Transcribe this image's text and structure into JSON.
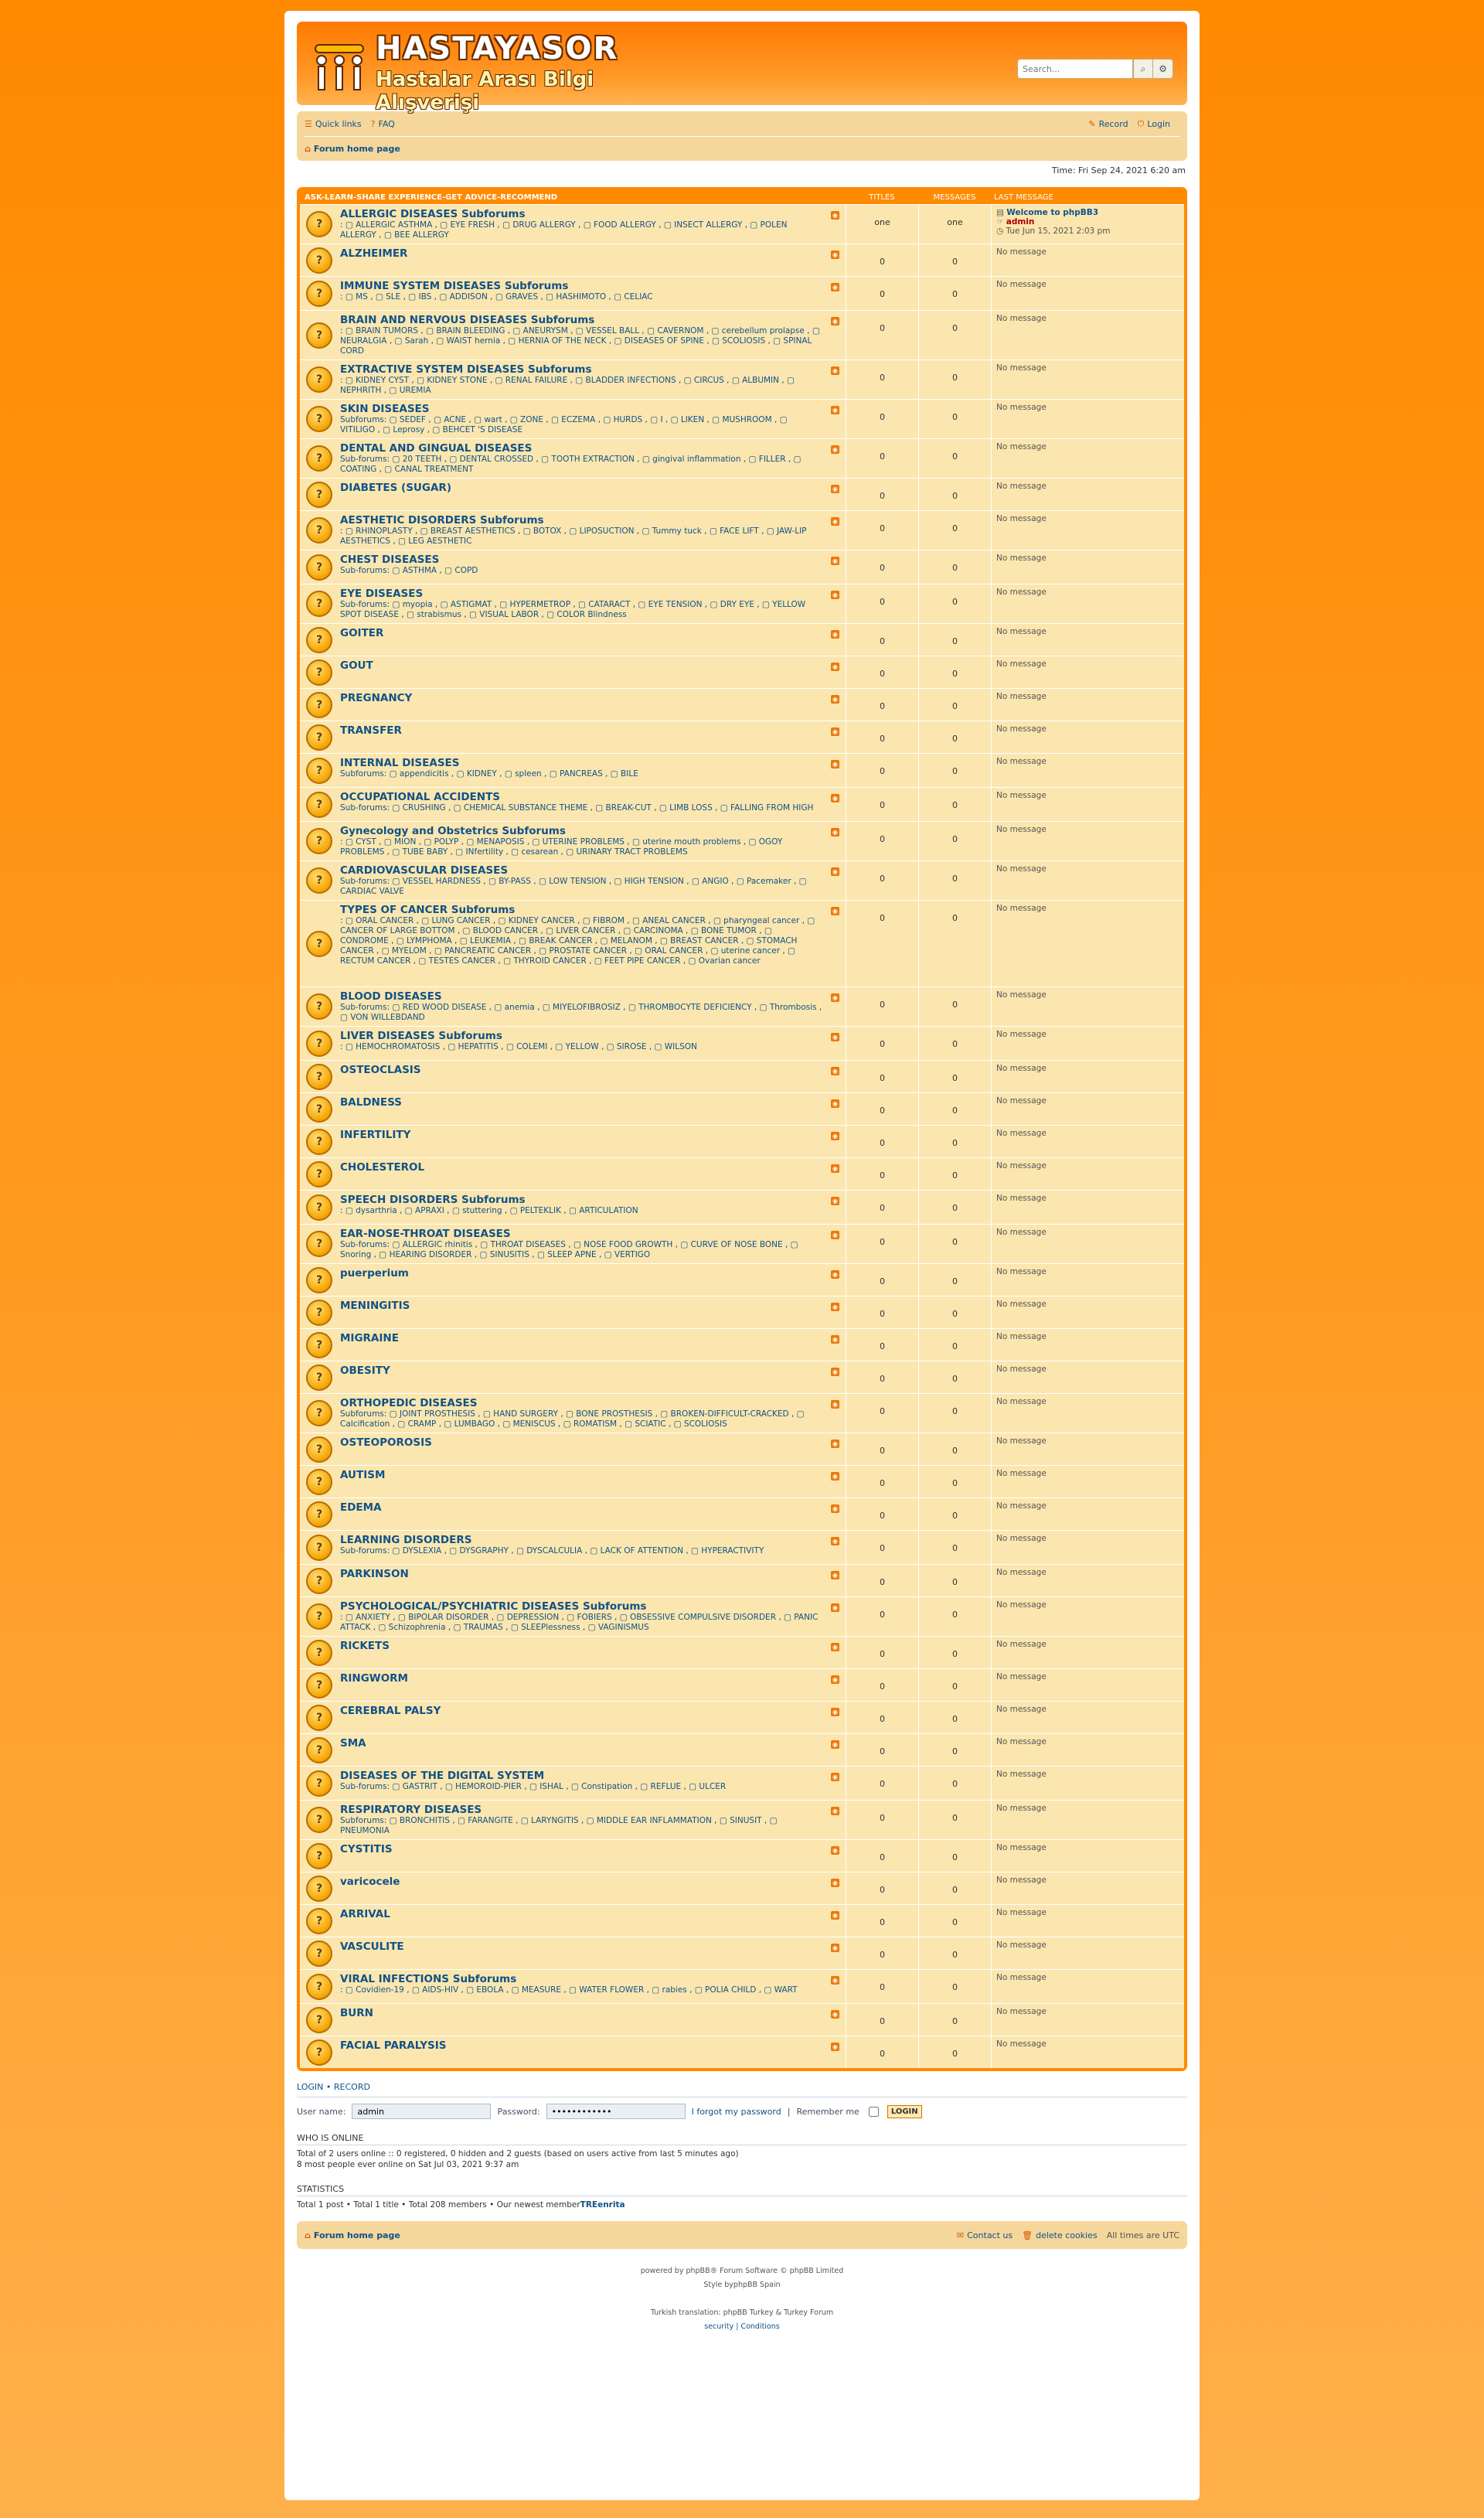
{
  "header": {
    "logo_title": "HASTAYASOR",
    "logo_subtitle": "Hastalar Arası Bilgi Alışverişi",
    "search_placeholder": "Search..."
  },
  "nav": {
    "quick_links": "Quick links",
    "faq": "FAQ",
    "register": "Record",
    "login": "Login",
    "breadcrumb": "Forum home page"
  },
  "time": "Time: Fri Sep 24, 2021 6:20 am",
  "category": {
    "title": "ASK-LEARN-SHARE EXPERIENCE-GET ADVICE-RECOMMEND",
    "col_titles": "TITLES",
    "col_messages": "MESSAGES",
    "col_last": "LAST MESSAGE"
  },
  "forums": [
    {
      "name": "ALLERGIC DISEASES Subforums",
      "subs": ": ▢ ALLERGIC ASTHMA , ▢ EYE FRESH , ▢ DRUG ALLERGY , ▢ FOOD ALLERGY , ▢ INSECT ALLERGY , ▢ POLEN ALLERGY , ▢ BEE ALLERGY",
      "titles": "one",
      "messages": "one",
      "last_title": "Welcome to phpBB3",
      "last_user": "admin",
      "last_date": "Tue Jun 15, 2021 2:03 pm"
    },
    {
      "name": "ALZHEIMER",
      "subs": "",
      "titles": "0",
      "messages": "0",
      "last": "No message"
    },
    {
      "name": "IMMUNE SYSTEM DISEASES Subforums",
      "subs": ": ▢ MS , ▢ SLE , ▢ IBS , ▢ ADDISON , ▢ GRAVES , ▢ HASHIMOTO , ▢ CELIAC",
      "titles": "0",
      "messages": "0",
      "last": "No message"
    },
    {
      "name": "BRAIN AND NERVOUS DISEASES Subforums",
      "subs": ": ▢ BRAIN TUMORS , ▢ BRAIN BLEEDING , ▢ ANEURYSM , ▢ VESSEL BALL , ▢ CAVERNOM , ▢ cerebellum prolapse , ▢ NEURALGIA , ▢ Sarah , ▢ WAIST hernia , ▢ HERNIA OF THE NECK , ▢ DISEASES OF SPINE , ▢ SCOLIOSIS , ▢ SPINAL CORD",
      "titles": "0",
      "messages": "0",
      "last": "No message"
    },
    {
      "name": "EXTRACTIVE SYSTEM DISEASES Subforums",
      "subs": ": ▢ KIDNEY CYST , ▢ KIDNEY STONE , ▢ RENAL FAILURE , ▢ BLADDER INFECTIONS , ▢ CIRCUS , ▢ ALBUMIN , ▢ NEPHRITH , ▢ UREMIA",
      "titles": "0",
      "messages": "0",
      "last": "No message"
    },
    {
      "name": "SKIN DISEASES",
      "subs": "Subforums: ▢ SEDEF , ▢ ACNE , ▢ wart , ▢ ZONE , ▢ ECZEMA , ▢ HURDS , ▢ I , ▢ LIKEN , ▢ MUSHROOM , ▢ VITILIGO , ▢ Leprosy , ▢ BEHCET 'S DISEASE",
      "titles": "0",
      "messages": "0",
      "last": "No message"
    },
    {
      "name": "DENTAL AND GINGUAL DISEASES",
      "subs": "Sub-forums: ▢ 20 TEETH , ▢ DENTAL CROSSED , ▢ TOOTH EXTRACTION , ▢ gingival inflammation , ▢ FILLER , ▢ COATING , ▢ CANAL TREATMENT",
      "titles": "0",
      "messages": "0",
      "last": "No message"
    },
    {
      "name": "DIABETES (SUGAR)",
      "subs": "",
      "titles": "0",
      "messages": "0",
      "last": "No message"
    },
    {
      "name": "AESTHETIC DISORDERS Subforums",
      "subs": ": ▢ RHINOPLASTY , ▢ BREAST AESTHETICS , ▢ BOTOX , ▢ LIPOSUCTION , ▢ Tummy tuck , ▢ FACE LIFT , ▢ JAW-LIP AESTHETICS , ▢ LEG AESTHETIC",
      "titles": "0",
      "messages": "0",
      "last": "No message"
    },
    {
      "name": "CHEST DISEASES",
      "subs": "Sub-forums: ▢ ASTHMA , ▢ COPD",
      "titles": "0",
      "messages": "0",
      "last": "No message"
    },
    {
      "name": "EYE DISEASES",
      "subs": "Sub-forums: ▢ myopia , ▢ ASTIGMAT , ▢ HYPERMETROP , ▢ CATARACT , ▢ EYE TENSION , ▢ DRY EYE , ▢ YELLOW SPOT DISEASE , ▢ strabismus , ▢ VISUAL LABOR , ▢ COLOR Blindness",
      "titles": "0",
      "messages": "0",
      "last": "No message"
    },
    {
      "name": "GOITER",
      "subs": "",
      "titles": "0",
      "messages": "0",
      "last": "No message"
    },
    {
      "name": "GOUT",
      "subs": "",
      "titles": "0",
      "messages": "0",
      "last": "No message"
    },
    {
      "name": "PREGNANCY",
      "subs": "",
      "titles": "0",
      "messages": "0",
      "last": "No message"
    },
    {
      "name": "TRANSFER",
      "subs": "",
      "titles": "0",
      "messages": "0",
      "last": "No message"
    },
    {
      "name": "INTERNAL DISEASES",
      "subs": "Subforums: ▢ appendicitis , ▢ KIDNEY , ▢ spleen , ▢ PANCREAS , ▢ BILE",
      "titles": "0",
      "messages": "0",
      "last": "No message"
    },
    {
      "name": "OCCUPATIONAL ACCIDENTS",
      "subs": "Sub-forums: ▢ CRUSHING , ▢ CHEMICAL SUBSTANCE THEME , ▢ BREAK-CUT , ▢ LIMB LOSS , ▢ FALLING FROM HIGH",
      "titles": "0",
      "messages": "0",
      "last": "No message"
    },
    {
      "name": "Gynecology and Obstetrics Subforums",
      "subs": ": ▢ CYST , ▢ MION , ▢ POLYP , ▢ MENAPOSIS , ▢ UTERINE PROBLEMS , ▢ uterine mouth problems , ▢ OGOY PROBLEMS , ▢ TUBE BABY , ▢ INfertility , ▢ cesarean , ▢ URINARY TRACT PROBLEMS",
      "titles": "0",
      "messages": "0",
      "last": "No message"
    },
    {
      "name": "CARDIOVASCULAR DISEASES",
      "subs": "Sub-forums: ▢ VESSEL HARDNESS , ▢ BY-PASS , ▢ LOW TENSION , ▢ HIGH TENSION , ▢ ANGIO , ▢ Pacemaker , ▢ CARDIAC VALVE",
      "titles": "0",
      "messages": "0",
      "last": "No message"
    },
    {
      "name": "TYPES OF CANCER Subforums",
      "subs": ": ▢ ORAL CANCER , ▢ LUNG CANCER , ▢ KIDNEY CANCER , ▢ FIBROM , ▢ ANEAL CANCER , ▢ pharyngeal cancer , ▢ CANCER OF LARGE BOTTOM , ▢ BLOOD CANCER , ▢ LIVER CANCER , ▢ CARCINOMA , ▢ BONE TUMOR , ▢ CONDROME , ▢ LYMPHOMA , ▢ LEUKEMIA , ▢ BREAK CANCER , ▢ MELANOM , ▢ BREAST CANCER , ▢ STOMACH CANCER , ▢ MYELOM , ▢ PANCREATIC CANCER , ▢ PROSTATE CANCER , ▢ ORAL CANCER , ▢ uterine cancer , ▢ RECTUM CANCER , ▢ TESTES CANCER , ▢ THYROID CANCER , ▢ FEET PIPE CANCER , ▢ Ovarian cancer",
      "titles": "0",
      "messages": "0",
      "last": "No message"
    },
    {
      "name": "BLOOD DISEASES",
      "subs": "Sub-forums: ▢ RED WOOD DISEASE , ▢ anemia , ▢ MIYELOFIBROSIZ , ▢ THROMBOCYTE DEFICIENCY , ▢ Thrombosis , ▢ VON WILLEBDAND",
      "titles": "0",
      "messages": "0",
      "last": "No message"
    },
    {
      "name": "LIVER DISEASES Subforums",
      "subs": ": ▢ HEMOCHROMATOSIS , ▢ HEPATITIS , ▢ COLEMI , ▢ YELLOW , ▢ SIROSE , ▢ WILSON",
      "titles": "0",
      "messages": "0",
      "last": "No message"
    },
    {
      "name": "OSTEOCLASIS",
      "subs": "",
      "titles": "0",
      "messages": "0",
      "last": "No message"
    },
    {
      "name": "BALDNESS",
      "subs": "",
      "titles": "0",
      "messages": "0",
      "last": "No message"
    },
    {
      "name": "INFERTILITY",
      "subs": "",
      "titles": "0",
      "messages": "0",
      "last": "No message"
    },
    {
      "name": "CHOLESTEROL",
      "subs": "",
      "titles": "0",
      "messages": "0",
      "last": "No message"
    },
    {
      "name": "SPEECH DISORDERS Subforums",
      "subs": ": ▢ dysarthria , ▢ APRAXI , ▢ stuttering , ▢ PELTEKLIK , ▢ ARTICULATION",
      "titles": "0",
      "messages": "0",
      "last": "No message"
    },
    {
      "name": "EAR-NOSE-THROAT DISEASES",
      "subs": "Sub-forums: ▢ ALLERGIC rhinitis , ▢ THROAT DISEASES , ▢ NOSE FOOD GROWTH , ▢ CURVE OF NOSE BONE , ▢ Snoring , ▢ HEARING DISORDER , ▢ SINUSITIS , ▢ SLEEP APNE , ▢ VERTIGO",
      "titles": "0",
      "messages": "0",
      "last": "No message"
    },
    {
      "name": "puerperium",
      "subs": "",
      "titles": "0",
      "messages": "0",
      "last": "No message"
    },
    {
      "name": "MENINGITIS",
      "subs": "",
      "titles": "0",
      "messages": "0",
      "last": "No message"
    },
    {
      "name": "MIGRAINE",
      "subs": "",
      "titles": "0",
      "messages": "0",
      "last": "No message"
    },
    {
      "name": "OBESITY",
      "subs": "",
      "titles": "0",
      "messages": "0",
      "last": "No message"
    },
    {
      "name": "ORTHOPEDIC DISEASES",
      "subs": "Subforums: ▢ JOINT PROSTHESIS , ▢ HAND SURGERY , ▢ BONE PROSTHESIS , ▢ BROKEN-DIFFICULT-CRACKED , ▢ Calcification , ▢ CRAMP , ▢ LUMBAGO , ▢ MENISCUS , ▢ ROMATISM , ▢ SCIATIC , ▢ SCOLIOSIS",
      "titles": "0",
      "messages": "0",
      "last": "No message"
    },
    {
      "name": "OSTEOPOROSIS",
      "subs": "",
      "titles": "0",
      "messages": "0",
      "last": "No message"
    },
    {
      "name": "AUTISM",
      "subs": "",
      "titles": "0",
      "messages": "0",
      "last": "No message"
    },
    {
      "name": "EDEMA",
      "subs": "",
      "titles": "0",
      "messages": "0",
      "last": "No message"
    },
    {
      "name": "LEARNING DISORDERS",
      "subs": "Sub-forums: ▢ DYSLEXIA , ▢ DYSGRAPHY , ▢ DYSCALCULIA , ▢ LACK OF ATTENTION , ▢ HYPERACTIVITY",
      "titles": "0",
      "messages": "0",
      "last": "No message"
    },
    {
      "name": "PARKINSON",
      "subs": "",
      "titles": "0",
      "messages": "0",
      "last": "No message"
    },
    {
      "name": "PSYCHOLOGICAL/PSYCHIATRIC DISEASES Subforums",
      "subs": ": ▢ ANXIETY , ▢ BIPOLAR DISORDER , ▢ DEPRESSION , ▢ FOBIERS , ▢ OBSESSIVE COMPULSIVE DISORDER , ▢ PANIC ATTACK , ▢ Schizophrenia , ▢ TRAUMAS , ▢ SLEEPlessness , ▢ VAGINISMUS",
      "titles": "0",
      "messages": "0",
      "last": "No message"
    },
    {
      "name": "RICKETS",
      "subs": "",
      "titles": "0",
      "messages": "0",
      "last": "No message"
    },
    {
      "name": "RINGWORM",
      "subs": "",
      "titles": "0",
      "messages": "0",
      "last": "No message"
    },
    {
      "name": "CEREBRAL PALSY",
      "subs": "",
      "titles": "0",
      "messages": "0",
      "last": "No message"
    },
    {
      "name": "SMA",
      "subs": "",
      "titles": "0",
      "messages": "0",
      "last": "No message"
    },
    {
      "name": "DISEASES OF THE DIGITAL SYSTEM",
      "subs": "Sub-forums: ▢ GASTRIT , ▢ HEMOROID-PIER , ▢ ISHAL , ▢ Constipation , ▢ REFLUE , ▢ ULCER",
      "titles": "0",
      "messages": "0",
      "last": "No message"
    },
    {
      "name": "RESPIRATORY DISEASES",
      "subs": "Subforums: ▢ BRONCHITIS , ▢ FARANGITE , ▢ LARYNGITIS , ▢ MIDDLE EAR INFLAMMATION , ▢ SINUSIT , ▢ PNEUMONIA",
      "titles": "0",
      "messages": "0",
      "last": "No message"
    },
    {
      "name": "CYSTITIS",
      "subs": "",
      "titles": "0",
      "messages": "0",
      "last": "No message"
    },
    {
      "name": "varicocele",
      "subs": "",
      "titles": "0",
      "messages": "0",
      "last": "No message"
    },
    {
      "name": "ARRIVAL",
      "subs": "",
      "titles": "0",
      "messages": "0",
      "last": "No message"
    },
    {
      "name": "VASCULITE",
      "subs": "",
      "titles": "0",
      "messages": "0",
      "last": "No message"
    },
    {
      "name": "VIRAL INFECTIONS Subforums",
      "subs": ": ▢ Covidien-19 , ▢ AIDS-HIV , ▢ EBOLA , ▢ MEASURE , ▢ WATER FLOWER , ▢ rabies , ▢ POLIA CHILD , ▢ WART",
      "titles": "0",
      "messages": "0",
      "last": "No message"
    },
    {
      "name": "BURN",
      "subs": "",
      "titles": "0",
      "messages": "0",
      "last": "No message"
    },
    {
      "name": "FACIAL PARALYSIS",
      "subs": "",
      "titles": "0",
      "messages": "0",
      "last": "No message"
    }
  ],
  "login": {
    "links_login": "LOGIN",
    "links_sep": "•",
    "links_record": "RECORD",
    "username_label": "User name:",
    "username_value": "admin",
    "password_label": "Password:",
    "password_value": "••••••••••••",
    "forgot": "I forgot my password",
    "sep": "|",
    "remember": "Remember me",
    "button": "LOGIN"
  },
  "online": {
    "heading": "WHO IS ONLINE",
    "line1": "Total of 2 users online :: 0 registered, 0 hidden and 2 guests (based on users active from last 5 minutes ago)",
    "line2": "8 most people ever online on Sat Jul 03, 2021 9:37 am"
  },
  "stats": {
    "heading": "STATISTICS",
    "line": "Total 1 post • Total 1 title • Total 208 members • Our newest member",
    "newest": "TREenrita"
  },
  "footer": {
    "home": "Forum home page",
    "contact": "Contact us",
    "cookies": "delete cookies",
    "times": "All times are UTC",
    "powered": "powered by phpBB® Forum Software © phpBB Limited",
    "style": "Style byphpBB Spain",
    "translation": "Turkish translation: phpBB Turkey & Turkey Forum",
    "privacy": "security | Conditions"
  }
}
